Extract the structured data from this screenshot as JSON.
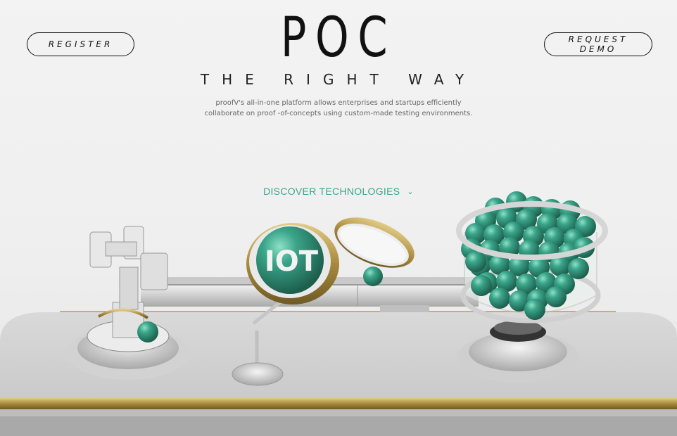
{
  "header": {
    "register_label": "REGISTER",
    "demo_label": "REQUEST DEMO",
    "title": "POC",
    "subtitle": "THE RIGHT WAY",
    "description_line1": "proof-of-concepts using custom-made testing environments.",
    "description": "proofV's all-in-one platform allows enterprises and startups efficiently collaborate on proof -of-concepts using custom-made testing environments."
  },
  "cta": {
    "discover_label": "DISCOVER TECHNOLOGIES",
    "chevron_icon": "chevron-down-icon"
  },
  "scene": {
    "lens_label": "IOT"
  },
  "colors": {
    "accent": "#3aa58a",
    "sphere": "#2f8f74",
    "gold": "#b89a4a",
    "text": "#111111"
  }
}
